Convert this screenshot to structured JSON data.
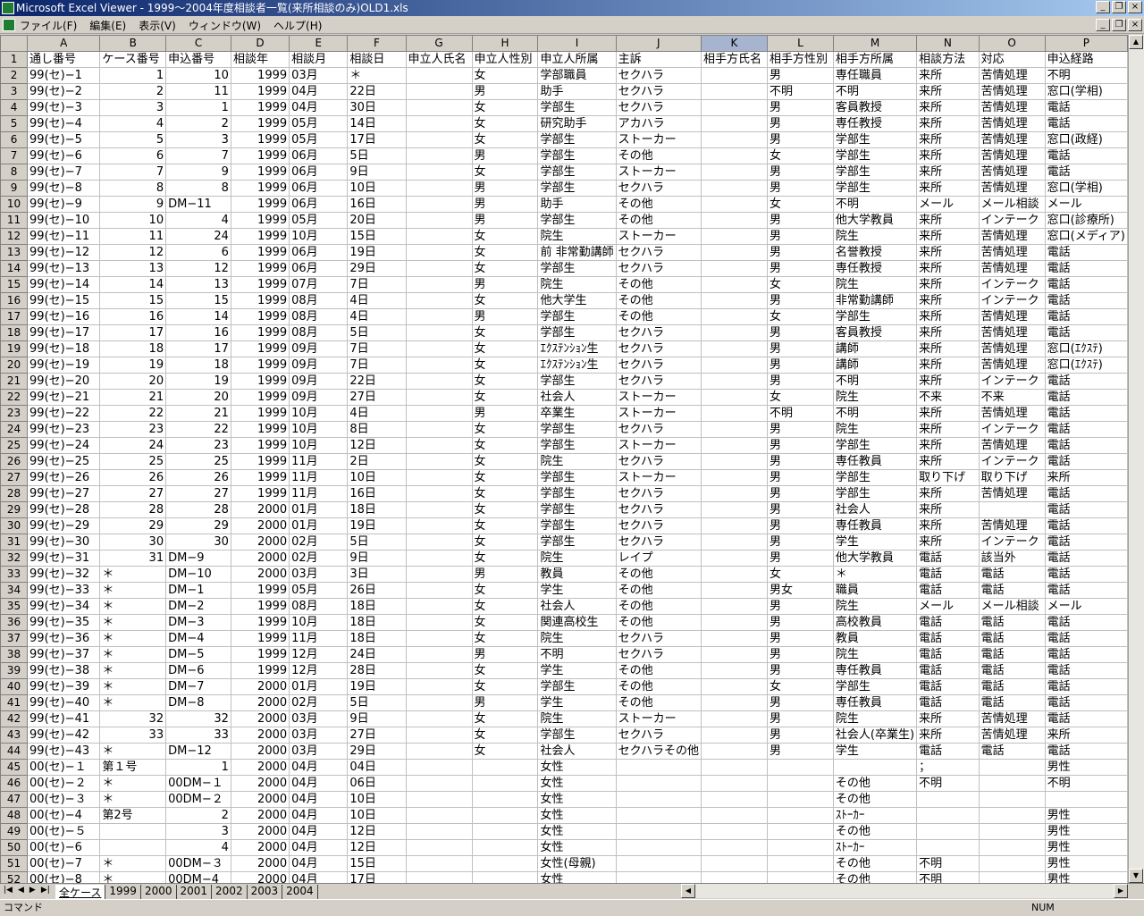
{
  "window": {
    "title": "Microsoft Excel Viewer - 1999～2004年度相談者一覧(来所相談のみ)OLD1.xls",
    "min": "_",
    "restore": "❐",
    "close": "×"
  },
  "menu": [
    "ファイル(F)",
    "編集(E)",
    "表示(V)",
    "ウィンドウ(W)",
    "ヘルプ(H)"
  ],
  "columns": [
    "A",
    "B",
    "C",
    "D",
    "E",
    "F",
    "G",
    "H",
    "I",
    "J",
    "K",
    "L",
    "M",
    "N",
    "O",
    "P"
  ],
  "header": [
    "通し番号",
    "ケース番号",
    "申込番号",
    "相談年",
    "相談月",
    "相談日",
    "申立人氏名",
    "申立人性別",
    "申立人所属",
    "主訴",
    "相手方氏名",
    "相手方性別",
    "相手方所属",
    "相談方法",
    "対応",
    "申込経路"
  ],
  "rows": [
    [
      "99(セ)−1",
      "1",
      "10",
      "1999",
      "03月",
      "＊",
      "",
      "女",
      "学部職員",
      "セクハラ",
      "",
      "男",
      "専任職員",
      "来所",
      "苦情処理",
      "不明"
    ],
    [
      "99(セ)−2",
      "2",
      "11",
      "1999",
      "04月",
      "22日",
      "",
      "男",
      "助手",
      "セクハラ",
      "",
      "不明",
      "不明",
      "来所",
      "苦情処理",
      "窓口(学相)"
    ],
    [
      "99(セ)−3",
      "3",
      "1",
      "1999",
      "04月",
      "30日",
      "",
      "女",
      "学部生",
      "セクハラ",
      "",
      "男",
      "客員教授",
      "来所",
      "苦情処理",
      "電話"
    ],
    [
      "99(セ)−4",
      "4",
      "2",
      "1999",
      "05月",
      "14日",
      "",
      "女",
      "研究助手",
      "アカハラ",
      "",
      "男",
      "専任教授",
      "来所",
      "苦情処理",
      "電話"
    ],
    [
      "99(セ)−5",
      "5",
      "3",
      "1999",
      "05月",
      "17日",
      "",
      "女",
      "学部生",
      "ストーカー",
      "",
      "男",
      "学部生",
      "来所",
      "苦情処理",
      "窓口(政経)"
    ],
    [
      "99(セ)−6",
      "6",
      "7",
      "1999",
      "06月",
      "5日",
      "",
      "男",
      "学部生",
      "その他",
      "",
      "女",
      "学部生",
      "来所",
      "苦情処理",
      "電話"
    ],
    [
      "99(セ)−7",
      "7",
      "9",
      "1999",
      "06月",
      "9日",
      "",
      "女",
      "学部生",
      "ストーカー",
      "",
      "男",
      "学部生",
      "来所",
      "苦情処理",
      "電話"
    ],
    [
      "99(セ)−8",
      "8",
      "8",
      "1999",
      "06月",
      "10日",
      "",
      "男",
      "学部生",
      "セクハラ",
      "",
      "男",
      "学部生",
      "来所",
      "苦情処理",
      "窓口(学相)"
    ],
    [
      "99(セ)−9",
      "9",
      "DM−11",
      "1999",
      "06月",
      "16日",
      "",
      "男",
      "助手",
      "その他",
      "",
      "女",
      "不明",
      "メール",
      "メール相談",
      "メール"
    ],
    [
      "99(セ)−10",
      "10",
      "4",
      "1999",
      "05月",
      "20日",
      "",
      "男",
      "学部生",
      "その他",
      "",
      "男",
      "他大学教員",
      "来所",
      "インテーク",
      "窓口(診療所)"
    ],
    [
      "99(セ)−11",
      "11",
      "24",
      "1999",
      "10月",
      "15日",
      "",
      "女",
      "院生",
      "ストーカー",
      "",
      "男",
      "院生",
      "来所",
      "苦情処理",
      "窓口(メディア)"
    ],
    [
      "99(セ)−12",
      "12",
      "6",
      "1999",
      "06月",
      "19日",
      "",
      "女",
      "前 非常勤講師",
      "セクハラ",
      "",
      "男",
      "名誉教授",
      "来所",
      "苦情処理",
      "電話"
    ],
    [
      "99(セ)−13",
      "13",
      "12",
      "1999",
      "06月",
      "29日",
      "",
      "女",
      "学部生",
      "セクハラ",
      "",
      "男",
      "専任教授",
      "来所",
      "苦情処理",
      "電話"
    ],
    [
      "99(セ)−14",
      "14",
      "13",
      "1999",
      "07月",
      "7日",
      "",
      "男",
      "院生",
      "その他",
      "",
      "女",
      "院生",
      "来所",
      "インテーク",
      "電話"
    ],
    [
      "99(セ)−15",
      "15",
      "15",
      "1999",
      "08月",
      "4日",
      "",
      "女",
      "他大学生",
      "その他",
      "",
      "男",
      "非常勤講師",
      "来所",
      "インテーク",
      "電話"
    ],
    [
      "99(セ)−16",
      "16",
      "14",
      "1999",
      "08月",
      "4日",
      "",
      "男",
      "学部生",
      "その他",
      "",
      "女",
      "学部生",
      "来所",
      "苦情処理",
      "電話"
    ],
    [
      "99(セ)−17",
      "17",
      "16",
      "1999",
      "08月",
      "5日",
      "",
      "女",
      "学部生",
      "セクハラ",
      "",
      "男",
      "客員教授",
      "来所",
      "苦情処理",
      "電話"
    ],
    [
      "99(セ)−18",
      "18",
      "17",
      "1999",
      "09月",
      "7日",
      "",
      "女",
      "ｴｸｽﾃﾝｼｮﾝ生",
      "セクハラ",
      "",
      "男",
      "講師",
      "来所",
      "苦情処理",
      "窓口(ｴｸｽﾃ)"
    ],
    [
      "99(セ)−19",
      "19",
      "18",
      "1999",
      "09月",
      "7日",
      "",
      "女",
      "ｴｸｽﾃﾝｼｮﾝ生",
      "セクハラ",
      "",
      "男",
      "講師",
      "来所",
      "苦情処理",
      "窓口(ｴｸｽﾃ)"
    ],
    [
      "99(セ)−20",
      "20",
      "19",
      "1999",
      "09月",
      "22日",
      "",
      "女",
      "学部生",
      "セクハラ",
      "",
      "男",
      "不明",
      "来所",
      "インテーク",
      "電話"
    ],
    [
      "99(セ)−21",
      "21",
      "20",
      "1999",
      "09月",
      "27日",
      "",
      "女",
      "社会人",
      "ストーカー",
      "",
      "女",
      "院生",
      "不来",
      "不来",
      "電話"
    ],
    [
      "99(セ)−22",
      "22",
      "21",
      "1999",
      "10月",
      "4日",
      "",
      "男",
      "卒業生",
      "ストーカー",
      "",
      "不明",
      "不明",
      "来所",
      "苦情処理",
      "電話"
    ],
    [
      "99(セ)−23",
      "23",
      "22",
      "1999",
      "10月",
      "8日",
      "",
      "女",
      "学部生",
      "セクハラ",
      "",
      "男",
      "院生",
      "来所",
      "インテーク",
      "電話"
    ],
    [
      "99(セ)−24",
      "24",
      "23",
      "1999",
      "10月",
      "12日",
      "",
      "女",
      "学部生",
      "ストーカー",
      "",
      "男",
      "学部生",
      "来所",
      "苦情処理",
      "電話"
    ],
    [
      "99(セ)−25",
      "25",
      "25",
      "1999",
      "11月",
      "2日",
      "",
      "女",
      "院生",
      "セクハラ",
      "",
      "男",
      "専任教員",
      "来所",
      "インテーク",
      "電話"
    ],
    [
      "99(セ)−26",
      "26",
      "26",
      "1999",
      "11月",
      "10日",
      "",
      "女",
      "学部生",
      "ストーカー",
      "",
      "男",
      "学部生",
      "取り下げ",
      "取り下げ",
      "来所"
    ],
    [
      "99(セ)−27",
      "27",
      "27",
      "1999",
      "11月",
      "16日",
      "",
      "女",
      "学部生",
      "セクハラ",
      "",
      "男",
      "学部生",
      "来所",
      "苦情処理",
      "電話"
    ],
    [
      "99(セ)−28",
      "28",
      "28",
      "2000",
      "01月",
      "18日",
      "",
      "女",
      "学部生",
      "セクハラ",
      "",
      "男",
      "社会人",
      "来所",
      "",
      "電話"
    ],
    [
      "99(セ)−29",
      "29",
      "29",
      "2000",
      "01月",
      "19日",
      "",
      "女",
      "学部生",
      "セクハラ",
      "",
      "男",
      "専任教員",
      "来所",
      "苦情処理",
      "電話"
    ],
    [
      "99(セ)−30",
      "30",
      "30",
      "2000",
      "02月",
      "5日",
      "",
      "女",
      "学部生",
      "セクハラ",
      "",
      "男",
      "学生",
      "来所",
      "インテーク",
      "電話"
    ],
    [
      "99(セ)−31",
      "31",
      "DM−9",
      "2000",
      "02月",
      "9日",
      "",
      "女",
      "院生",
      "レイプ",
      "",
      "男",
      "他大学教員",
      "電話",
      "該当外",
      "電話"
    ],
    [
      "99(セ)−32",
      "＊",
      "DM−10",
      "2000",
      "03月",
      "3日",
      "",
      "男",
      "教員",
      "その他",
      "",
      "女",
      "＊",
      "電話",
      "電話",
      "電話"
    ],
    [
      "99(セ)−33",
      "＊",
      "DM−1",
      "1999",
      "05月",
      "26日",
      "",
      "女",
      "学生",
      "その他",
      "",
      "男女",
      "職員",
      "電話",
      "電話",
      "電話"
    ],
    [
      "99(セ)−34",
      "＊",
      "DM−2",
      "1999",
      "08月",
      "18日",
      "",
      "女",
      "社会人",
      "その他",
      "",
      "男",
      "院生",
      "メール",
      "メール相談",
      "メール"
    ],
    [
      "99(セ)−35",
      "＊",
      "DM−3",
      "1999",
      "10月",
      "18日",
      "",
      "女",
      "関連高校生",
      "その他",
      "",
      "男",
      "高校教員",
      "電話",
      "電話",
      "電話"
    ],
    [
      "99(セ)−36",
      "＊",
      "DM−4",
      "1999",
      "11月",
      "18日",
      "",
      "女",
      "院生",
      "セクハラ",
      "",
      "男",
      "教員",
      "電話",
      "電話",
      "電話"
    ],
    [
      "99(セ)−37",
      "＊",
      "DM−5",
      "1999",
      "12月",
      "24日",
      "",
      "男",
      "不明",
      "セクハラ",
      "",
      "男",
      "院生",
      "電話",
      "電話",
      "電話"
    ],
    [
      "99(セ)−38",
      "＊",
      "DM−6",
      "1999",
      "12月",
      "28日",
      "",
      "女",
      "学生",
      "その他",
      "",
      "男",
      "専任教員",
      "電話",
      "電話",
      "電話"
    ],
    [
      "99(セ)−39",
      "＊",
      "DM−7",
      "2000",
      "01月",
      "19日",
      "",
      "女",
      "学部生",
      "その他",
      "",
      "女",
      "学部生",
      "電話",
      "電話",
      "電話"
    ],
    [
      "99(セ)−40",
      "＊",
      "DM−8",
      "2000",
      "02月",
      "5日",
      "",
      "男",
      "学生",
      "その他",
      "",
      "男",
      "専任教員",
      "電話",
      "電話",
      "電話"
    ],
    [
      "99(セ)−41",
      "32",
      "32",
      "2000",
      "03月",
      "9日",
      "",
      "女",
      "院生",
      "ストーカー",
      "",
      "男",
      "院生",
      "来所",
      "苦情処理",
      "電話"
    ],
    [
      "99(セ)−42",
      "33",
      "33",
      "2000",
      "03月",
      "27日",
      "",
      "女",
      "学部生",
      "セクハラ",
      "",
      "男",
      "社会人(卒業生)",
      "来所",
      "苦情処理",
      "来所"
    ],
    [
      "99(セ)−43",
      "＊",
      "DM−12",
      "2000",
      "03月",
      "29日",
      "",
      "女",
      "社会人",
      "セクハラその他",
      "",
      "男",
      "学生",
      "電話",
      "電話",
      "電話"
    ],
    [
      "00(セ)−１",
      "第１号",
      "1",
      "2000",
      "04月",
      "04日",
      "",
      "",
      "女性",
      "",
      "",
      "",
      "",
      "；",
      "",
      "男性"
    ],
    [
      "00(セ)−２",
      "＊",
      "00DM−１",
      "2000",
      "04月",
      "06日",
      "",
      "",
      "女性",
      "",
      "",
      "",
      "その他",
      "不明",
      "",
      "不明"
    ],
    [
      "00(セ)−３",
      "＊",
      "00DM−２",
      "2000",
      "04月",
      "10日",
      "",
      "",
      "女性",
      "",
      "",
      "",
      "その他",
      "",
      "",
      ""
    ],
    [
      "00(セ)−4",
      "第2号",
      "2",
      "2000",
      "04月",
      "10日",
      "",
      "",
      "女性",
      "",
      "",
      "",
      "ｽﾄｰｶｰ",
      "",
      "",
      "男性"
    ],
    [
      "00(セ)−５",
      "",
      "3",
      "2000",
      "04月",
      "12日",
      "",
      "",
      "女性",
      "",
      "",
      "",
      "その他",
      "",
      "",
      "男性"
    ],
    [
      "00(セ)−6",
      "",
      "4",
      "2000",
      "04月",
      "12日",
      "",
      "",
      "女性",
      "",
      "",
      "",
      "ｽﾄｰｶｰ",
      "",
      "",
      "男性"
    ],
    [
      "00(セ)−7",
      "＊",
      "00DM−３",
      "2000",
      "04月",
      "15日",
      "",
      "",
      "女性(母親)",
      "",
      "",
      "",
      "その他",
      "不明",
      "",
      "男性"
    ],
    [
      "00(セ)−8",
      "＊",
      "00DM−4",
      "2000",
      "04月",
      "17日",
      "",
      "",
      "女性",
      "",
      "",
      "",
      "その他",
      "不明",
      "",
      "男性"
    ]
  ],
  "sheet_tabs": [
    "全ケース",
    "1999",
    "2000",
    "2001",
    "2002",
    "2003",
    "2004"
  ],
  "status": {
    "mode": "コマンド",
    "num": "NUM"
  }
}
